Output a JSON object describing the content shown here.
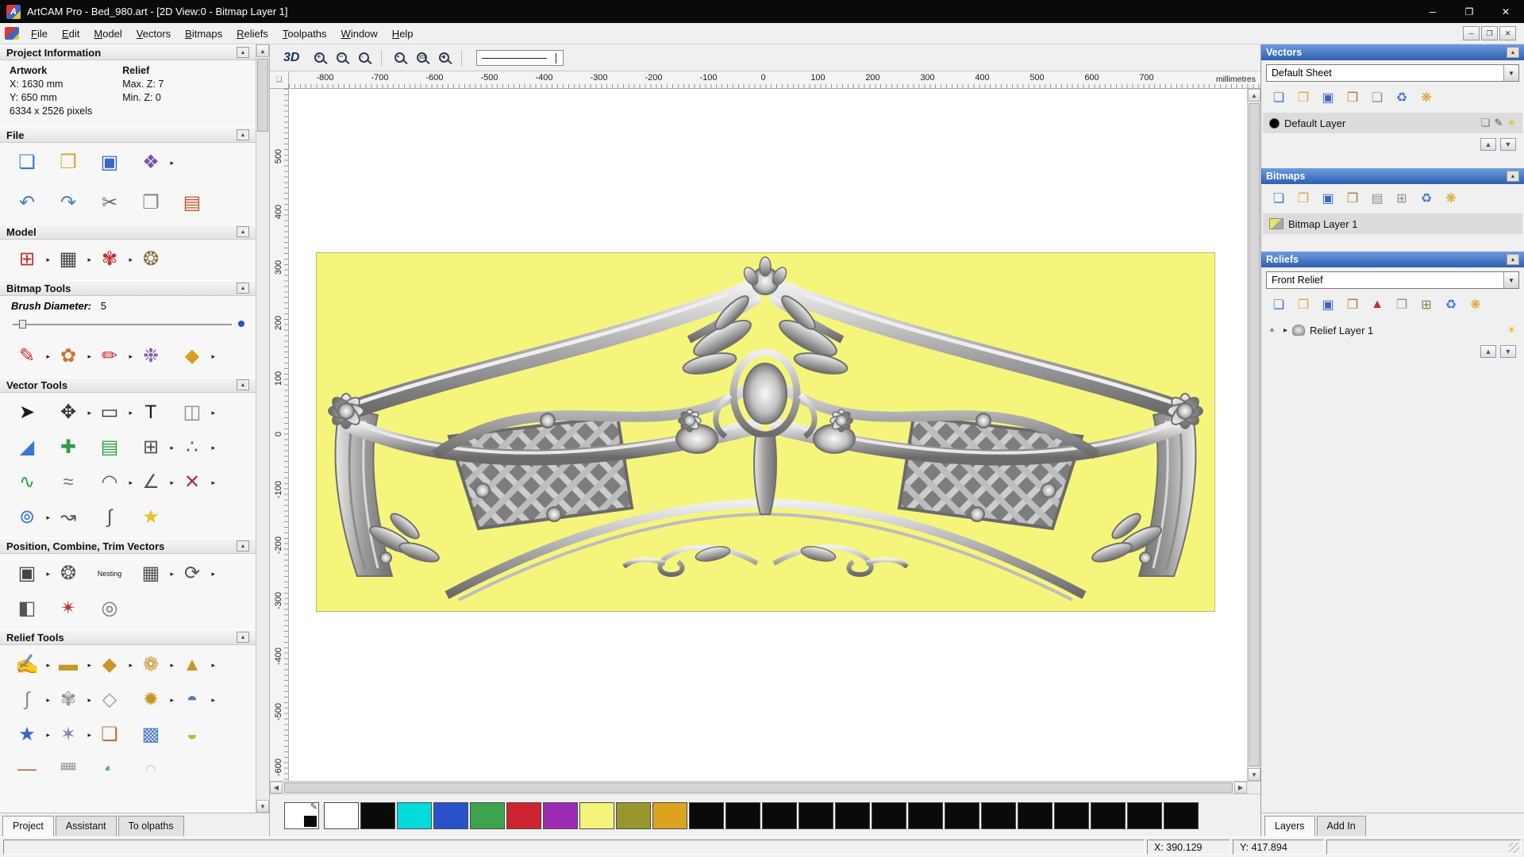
{
  "titlebar": {
    "app_glyph": "A",
    "title": "ArtCAM Pro - Bed_980.art - [2D View:0 - Bitmap Layer 1]",
    "minimize_label": "─",
    "maximize_label": "❐",
    "close_label": "✕"
  },
  "menubar": {
    "items": [
      {
        "label": "File",
        "name": "menu-file"
      },
      {
        "label": "Edit",
        "name": "menu-edit"
      },
      {
        "label": "Model",
        "name": "menu-model"
      },
      {
        "label": "Vectors",
        "name": "menu-vectors"
      },
      {
        "label": "Bitmaps",
        "name": "menu-bitmaps"
      },
      {
        "label": "Reliefs",
        "name": "menu-reliefs"
      },
      {
        "label": "Toolpaths",
        "name": "menu-toolpaths"
      },
      {
        "label": "Window",
        "name": "menu-window"
      },
      {
        "label": "Help",
        "name": "menu-help"
      }
    ],
    "child_minimize": "─",
    "child_restore": "❐",
    "child_close": "✕"
  },
  "left_panel": {
    "project_info": {
      "title": "Project Information",
      "artwork_label": "Artwork",
      "relief_label": "Relief",
      "x_value": "X: 1630 mm",
      "y_value": "Y: 650 mm",
      "pixels": "6334 x 2526 pixels",
      "max_z": "Max. Z: 7",
      "min_z": "Min. Z: 0"
    },
    "file_section": {
      "title": "File",
      "row1": [
        {
          "name": "new-model-icon",
          "glyph": "❏",
          "color": "#3a76d2",
          "flyout": "false"
        },
        {
          "name": "open-model-icon",
          "glyph": "❒",
          "color": "#e0a33a",
          "flyout": "false"
        },
        {
          "name": "save-model-icon",
          "glyph": "▣",
          "color": "#3a66c9",
          "flyout": "false"
        },
        {
          "name": "import-export-icon",
          "glyph": "❖",
          "color": "#7b52ab",
          "flyout": "true"
        }
      ],
      "row2": [
        {
          "name": "undo-icon",
          "glyph": "↶",
          "color": "#4a7ec9",
          "flyout": "false"
        },
        {
          "name": "redo-icon",
          "glyph": "↷",
          "color": "#4a7ec9",
          "flyout": "false"
        },
        {
          "name": "cut-icon",
          "glyph": "✂",
          "color": "#666666",
          "flyout": "false"
        },
        {
          "name": "copy-icon",
          "glyph": "❐",
          "color": "#888888",
          "flyout": "false"
        },
        {
          "name": "paste-icon",
          "glyph": "▤",
          "color": "#c05a2e",
          "flyout": "false"
        }
      ]
    },
    "model_section": {
      "title": "Model",
      "tools": [
        {
          "name": "set-model-size-icon",
          "glyph": "⊞",
          "color": "#c03030",
          "flyout": "true"
        },
        {
          "name": "adjust-model-icon",
          "glyph": "▦",
          "color": "#444444",
          "flyout": "true"
        },
        {
          "name": "scale-model-icon",
          "glyph": "✾",
          "color": "#c03030",
          "flyout": "true"
        },
        {
          "name": "model-picture-icon",
          "glyph": "❂",
          "color": "#8a6d3b",
          "flyout": "false"
        }
      ]
    },
    "bitmap_section": {
      "title": "Bitmap Tools",
      "brush_label": "Brush Diameter:",
      "brush_value": "5",
      "tools": [
        {
          "name": "paint-brush-icon",
          "glyph": "✎",
          "color": "#cc2b2b",
          "flyout": "true"
        },
        {
          "name": "paint-selective-icon",
          "glyph": "✿",
          "color": "#d07030",
          "flyout": "true"
        },
        {
          "name": "draw-icon",
          "glyph": "✏",
          "color": "#cc2b2b",
          "flyout": "true"
        },
        {
          "name": "colour-palette-icon",
          "glyph": "❉",
          "color": "#8a5fb0",
          "flyout": "false"
        },
        {
          "name": "flood-fill-icon",
          "glyph": "◆",
          "color": "#d8a020",
          "flyout": "true"
        }
      ]
    },
    "vector_section": {
      "title": "Vector Tools",
      "tools": [
        {
          "name": "select-vectors-icon",
          "glyph": "➤",
          "color": "#1a1a1a",
          "flyout": "false"
        },
        {
          "name": "transform-vectors-icon",
          "glyph": "✥",
          "color": "#333333",
          "flyout": "true"
        },
        {
          "name": "create-rectangle-icon",
          "glyph": "▭",
          "color": "#333333",
          "flyout": "true"
        },
        {
          "name": "create-text-icon",
          "glyph": "T",
          "color": "#1a1a1a",
          "flyout": "false"
        },
        {
          "name": "measure-icon",
          "glyph": "◫",
          "color": "#888888",
          "flyout": "true"
        },
        {
          "name": "node-editing-icon",
          "glyph": "◢",
          "color": "#3a76d2",
          "flyout": "false"
        },
        {
          "name": "paste-along-curve-icon",
          "glyph": "✚",
          "color": "#2f9e44",
          "flyout": "false"
        },
        {
          "name": "text-frame-icon",
          "glyph": "▤",
          "color": "#2f9e44",
          "flyout": "false"
        },
        {
          "name": "snap-grid-icon",
          "glyph": "⊞",
          "color": "#555555",
          "flyout": "true"
        },
        {
          "name": "create-points-icon",
          "glyph": "∴",
          "color": "#555555",
          "flyout": "true"
        },
        {
          "name": "create-polyline-icon",
          "glyph": "∿",
          "color": "#2f9e44",
          "flyout": "false"
        },
        {
          "name": "create-freehand-icon",
          "glyph": "≈",
          "color": "#777777",
          "flyout": "false"
        },
        {
          "name": "create-arc-icon",
          "glyph": "◠",
          "color": "#555555",
          "flyout": "true"
        },
        {
          "name": "join-vectors-icon",
          "glyph": "∠",
          "color": "#555555",
          "flyout": "true"
        },
        {
          "name": "trim-vectors-icon",
          "glyph": "✕",
          "color": "#b03030",
          "flyout": "true"
        },
        {
          "name": "create-circle-icon",
          "glyph": "⊚",
          "color": "#3a76d2",
          "flyout": "true"
        },
        {
          "name": "create-curve-icon",
          "glyph": "↝",
          "color": "#555555",
          "flyout": "false"
        },
        {
          "name": "node-tool-icon",
          "glyph": "∫",
          "color": "#555555",
          "flyout": "false"
        },
        {
          "name": "create-star-icon",
          "glyph": "★",
          "color": "#e8c227",
          "flyout": "false"
        }
      ]
    },
    "position_section": {
      "title": "Position, Combine, Trim Vectors",
      "tools": [
        {
          "name": "align-vectors-icon",
          "glyph": "▣",
          "color": "#444444",
          "flyout": "true"
        },
        {
          "name": "circular-copy-icon",
          "glyph": "❂",
          "color": "#555555",
          "flyout": "false"
        },
        {
          "name": "nesting-icon",
          "glyph": "Nesting",
          "color": "#111111",
          "flyout": "false",
          "fs": "9px"
        },
        {
          "name": "block-copy-icon",
          "glyph": "▦",
          "color": "#555555",
          "flyout": "true"
        },
        {
          "name": "rotate-copy-icon",
          "glyph": "⟳",
          "color": "#555555",
          "flyout": "true"
        },
        {
          "name": "mirror-vectors-icon",
          "glyph": "◧",
          "color": "#555555",
          "flyout": "false"
        },
        {
          "name": "weld-vectors-icon",
          "glyph": "✴",
          "color": "#c03030",
          "flyout": "false"
        },
        {
          "name": "spiral-icon",
          "glyph": "◎",
          "color": "#777777",
          "flyout": "false"
        }
      ]
    },
    "relief_section": {
      "title": "Relief Tools",
      "tools": [
        {
          "name": "sculpting-icon",
          "glyph": "✍",
          "color": "#c9962b",
          "flyout": "true"
        },
        {
          "name": "smoothing-icon",
          "glyph": "▬",
          "color": "#c9962b",
          "flyout": "true"
        },
        {
          "name": "shape-editor-icon",
          "glyph": "◆",
          "color": "#c9962b",
          "flyout": "true"
        },
        {
          "name": "texture-relief-icon",
          "glyph": "❁",
          "color": "#c9962b",
          "flyout": "true"
        },
        {
          "name": "two-rail-sweep-icon",
          "glyph": "▲",
          "color": "#c9962b",
          "flyout": "true"
        },
        {
          "name": "extrude-icon",
          "glyph": "∫",
          "color": "#888888",
          "flyout": "true"
        },
        {
          "name": "weave-wizard-icon",
          "glyph": "✾",
          "color": "#999999",
          "flyout": "true"
        },
        {
          "name": "turn-icon",
          "glyph": "◇",
          "color": "#999999",
          "flyout": "false"
        },
        {
          "name": "spin-icon",
          "glyph": "✹",
          "color": "#c9962b",
          "flyout": "true"
        },
        {
          "name": "emboss-wizard-icon",
          "glyph": "◓",
          "color": "#4a7ec9",
          "flyout": "true"
        },
        {
          "name": "star-wizard-icon",
          "glyph": "★",
          "color": "#3a66c9",
          "flyout": "true"
        },
        {
          "name": "wrap-relief-icon",
          "glyph": "✶",
          "color": "#8888aa",
          "flyout": "true"
        },
        {
          "name": "paste-relief-icon",
          "glyph": "❏",
          "color": "#c06c3c",
          "flyout": "false"
        },
        {
          "name": "texture-map-icon",
          "glyph": "▩",
          "color": "#4a7ec9",
          "flyout": "false"
        },
        {
          "name": "offset-relief-icon",
          "glyph": "◒",
          "color": "#b0c030",
          "flyout": "false"
        },
        {
          "name": "constant-height-icon",
          "glyph": "▬",
          "color": "#c03030",
          "flyout": "false"
        },
        {
          "name": "mesh-creator-icon",
          "glyph": "▦",
          "color": "#999999",
          "flyout": "false"
        },
        {
          "name": "blend-relief-icon",
          "glyph": "◐",
          "color": "#55aaaa",
          "flyout": "false"
        },
        {
          "name": "fade-relief-icon",
          "glyph": "◌",
          "color": "#999999",
          "flyout": "false"
        }
      ]
    },
    "tabs": [
      {
        "label": "Project",
        "name": "tab-project",
        "active": "true"
      },
      {
        "label": "Assistant",
        "name": "tab-assistant",
        "active": "false"
      },
      {
        "label": "To olpaths",
        "name": "tab-toolpaths-unused",
        "active": "false"
      }
    ]
  },
  "canvas": {
    "toolbar": {
      "view_3d": "3D",
      "zoom_group1": [
        {
          "name": "zoom-in-icon",
          "badge": "+"
        },
        {
          "name": "zoom-out-icon",
          "badge": "−"
        },
        {
          "name": "zoom-window-icon",
          "badge": "▫"
        }
      ],
      "zoom_group2": [
        {
          "name": "zoom-objects-icon",
          "badge": "▪"
        },
        {
          "name": "zoom-page-icon",
          "badge": "▭"
        },
        {
          "name": "zoom-previous-icon",
          "badge": "◂"
        }
      ]
    },
    "h_ruler": [
      "-800",
      "-700",
      "-600",
      "-500",
      "-400",
      "-300",
      "-200",
      "-100",
      "0",
      "100",
      "200",
      "300",
      "400",
      "500",
      "600",
      "700"
    ],
    "v_ruler": [
      "500",
      "400",
      "300",
      "200",
      "100",
      "0",
      "-100",
      "-200",
      "-300",
      "-400",
      "-500",
      "-600"
    ],
    "ruler_unit": "millimetres",
    "artwork_background": "#f5f57c"
  },
  "palette": {
    "colors": [
      {
        "c": "#ffffff"
      },
      {
        "c": "#0a0a0a"
      },
      {
        "c": "#00dcdc"
      },
      {
        "c": "#2a52c8"
      },
      {
        "c": "#3fa24d"
      },
      {
        "c": "#cf2430"
      },
      {
        "c": "#9c2bb4"
      },
      {
        "c": "#f4f478"
      },
      {
        "c": "#97972e"
      },
      {
        "c": "#dca41e"
      },
      {
        "c": "#0a0a0a"
      },
      {
        "c": "#0a0a0a"
      },
      {
        "c": "#0a0a0a"
      },
      {
        "c": "#0a0a0a"
      },
      {
        "c": "#0a0a0a"
      },
      {
        "c": "#0a0a0a"
      },
      {
        "c": "#0a0a0a"
      },
      {
        "c": "#0a0a0a"
      },
      {
        "c": "#0a0a0a"
      },
      {
        "c": "#0a0a0a"
      },
      {
        "c": "#0a0a0a"
      },
      {
        "c": "#0a0a0a"
      },
      {
        "c": "#0a0a0a"
      },
      {
        "c": "#0a0a0a"
      }
    ]
  },
  "right_panel": {
    "vectors": {
      "title": "Vectors",
      "sheet": "Default Sheet",
      "toolbar": [
        {
          "name": "new-vector-layer-icon",
          "glyph": "❏",
          "color": "#3a76d2"
        },
        {
          "name": "open-vector-layer-icon",
          "glyph": "❒",
          "color": "#e0a33a"
        },
        {
          "name": "save-vector-layer-icon",
          "glyph": "▣",
          "color": "#3a66c9"
        },
        {
          "name": "import-vectors-icon",
          "glyph": "❒",
          "color": "#a97b3c"
        },
        {
          "name": "export-vectors-icon",
          "glyph": "❏",
          "color": "#8d8d8d"
        },
        {
          "name": "delete-layer-icon",
          "glyph": "♻",
          "color": "#3a76d2"
        },
        {
          "name": "toggle-all-layers-icon",
          "glyph": "❋",
          "color": "#d8a020"
        }
      ],
      "layer_name": "Default Layer",
      "layer_swatch": "#000000",
      "layer_icons": [
        {
          "name": "layer-lock-icon",
          "glyph": "❑",
          "color": "#777777"
        },
        {
          "name": "layer-edit-icon",
          "glyph": "✎",
          "color": "#555555"
        },
        {
          "name": "layer-visibility-icon",
          "glyph": "☀",
          "color": "#e3b715"
        }
      ]
    },
    "bitmaps": {
      "title": "Bitmaps",
      "toolbar": [
        {
          "name": "new-bitmap-layer-icon",
          "glyph": "❏",
          "color": "#3a76d2"
        },
        {
          "name": "open-bitmap-layer-icon",
          "glyph": "❒",
          "color": "#e0a33a"
        },
        {
          "name": "save-bitmap-layer-icon",
          "glyph": "▣",
          "color": "#3a66c9"
        },
        {
          "name": "import-bitmap-icon",
          "glyph": "❒",
          "color": "#a97b3c"
        },
        {
          "name": "merge-layers-icon",
          "glyph": "▤",
          "color": "#8d8d8d"
        },
        {
          "name": "combine-layers-icon",
          "glyph": "⊞",
          "color": "#8d8d8d"
        },
        {
          "name": "delete-layer-icon",
          "glyph": "♻",
          "color": "#3a76d2"
        },
        {
          "name": "toggle-all-layers-icon",
          "glyph": "❋",
          "color": "#d8a020"
        }
      ],
      "layer_name": "Bitmap Layer 1"
    },
    "reliefs": {
      "title": "Reliefs",
      "selector": "Front Relief",
      "toolbar": [
        {
          "name": "new-relief-layer-icon",
          "glyph": "❏",
          "color": "#3a76d2"
        },
        {
          "name": "open-relief-layer-icon",
          "glyph": "❒",
          "color": "#e0a33a"
        },
        {
          "name": "save-relief-layer-icon",
          "glyph": "▣",
          "color": "#3a66c9"
        },
        {
          "name": "import-relief-icon",
          "glyph": "❒",
          "color": "#a97b3c"
        },
        {
          "name": "smooth-relief-icon",
          "glyph": "▲",
          "color": "#c03030"
        },
        {
          "name": "duplicate-relief-icon",
          "glyph": "❐",
          "color": "#8d8d8d"
        },
        {
          "name": "calculate-relief-icon",
          "glyph": "⊞",
          "color": "#6d8d4d"
        },
        {
          "name": "delete-layer-icon",
          "glyph": "♻",
          "color": "#3a76d2"
        },
        {
          "name": "toggle-all-layers-icon",
          "glyph": "❋",
          "color": "#d8a020"
        }
      ],
      "layer_name": "Relief Layer 1",
      "layer_icons": [
        {
          "name": "layer-visibility-icon",
          "glyph": "☀",
          "color": "#e3b715"
        }
      ]
    },
    "tabs": [
      {
        "label": "Layers",
        "name": "tab-layers",
        "active": "true"
      },
      {
        "label": "Add In",
        "name": "tab-add-in",
        "active": "false"
      }
    ]
  },
  "statusbar": {
    "x": "X: 390.129",
    "y": "Y: 417.894"
  }
}
